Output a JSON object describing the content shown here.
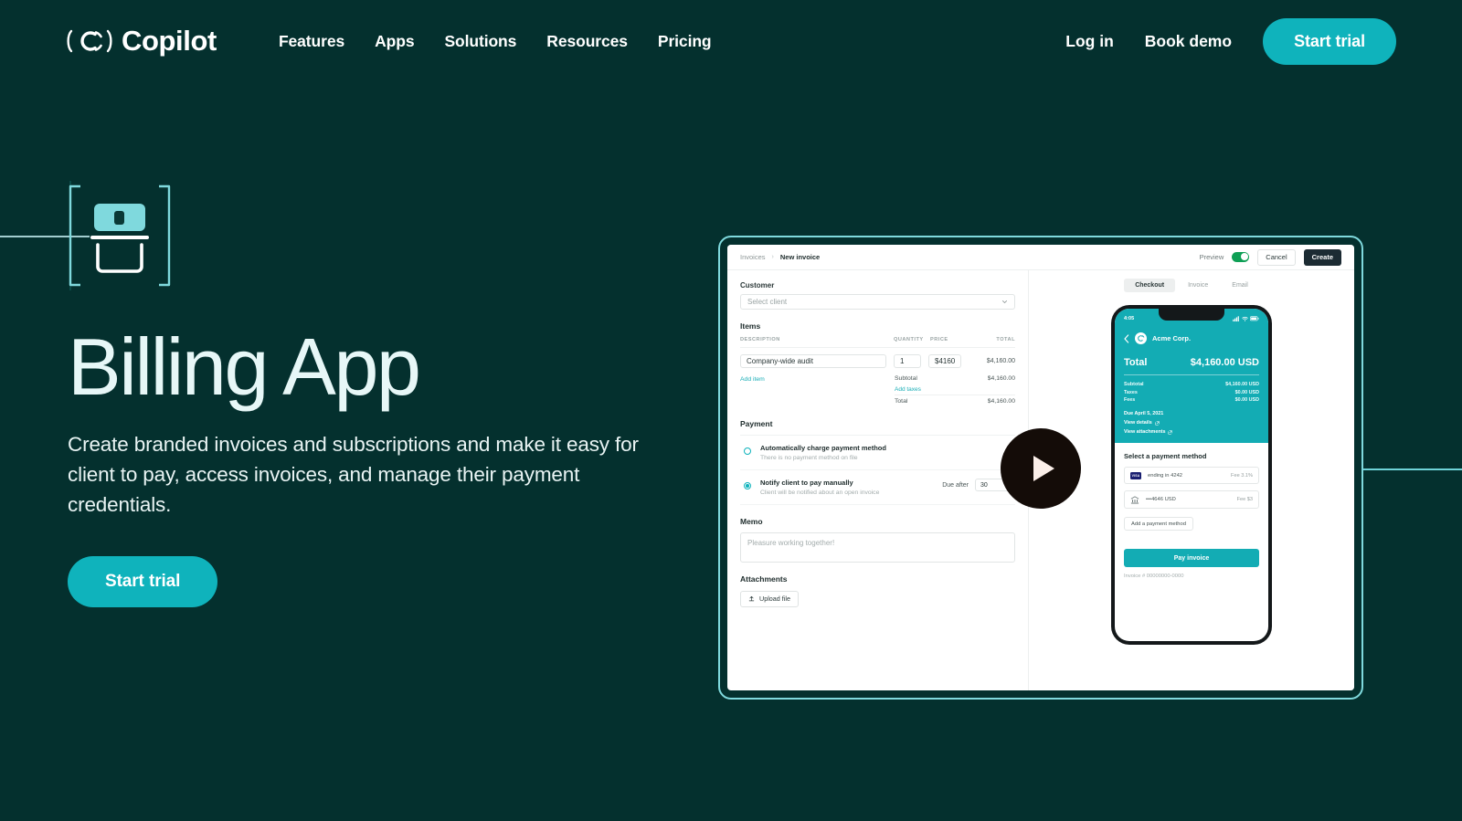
{
  "brand": {
    "name": "Copilot",
    "logo_icon": "copilot-c-bracket-logo"
  },
  "nav": {
    "links": [
      {
        "label": "Features"
      },
      {
        "label": "Apps"
      },
      {
        "label": "Solutions"
      },
      {
        "label": "Resources"
      },
      {
        "label": "Pricing"
      }
    ],
    "login_label": "Log in",
    "demo_label": "Book demo",
    "cta_label": "Start trial"
  },
  "hero": {
    "icon": "billing-card-bracket-icon",
    "title": "Billing App",
    "subtitle": "Create branded invoices and subscriptions and make it easy for client to pay, access invoices, and manage their payment credentials.",
    "cta_label": "Start trial"
  },
  "video": {
    "play_icon": "play-icon"
  },
  "app": {
    "breadcrumb": {
      "parent": "Invoices",
      "separator": "›",
      "current": "New invoice"
    },
    "topbar": {
      "preview_label": "Preview",
      "preview_on": true,
      "cancel_label": "Cancel",
      "create_label": "Create"
    },
    "form": {
      "customer_label": "Customer",
      "customer_placeholder": "Select client",
      "items_label": "Items",
      "item_columns": [
        "DESCRIPTION",
        "QUANTITY",
        "PRICE",
        "TOTAL"
      ],
      "items": [
        {
          "description": "Company-wide audit",
          "quantity": "1",
          "price": "$4160",
          "total": "$4,160.00"
        }
      ],
      "add_item_label": "Add item",
      "subtotal_label": "Subtotal",
      "subtotal_value": "$4,160.00",
      "add_taxes_label": "Add taxes",
      "total_label": "Total",
      "total_value": "$4,160.00",
      "payment_label": "Payment",
      "payment_options": [
        {
          "title": "Automatically charge payment method",
          "subtitle": "There is no payment method on file",
          "selected": false
        },
        {
          "title": "Notify client to pay manually",
          "subtitle": "Client will be notified about an open invoice",
          "selected": true
        }
      ],
      "due_after_label": "Due after",
      "due_after_value": "30",
      "memo_label": "Memo",
      "memo_placeholder": "Pleasure working together!",
      "attachments_label": "Attachments",
      "upload_label": "Upload file",
      "upload_icon": "upload-icon"
    },
    "preview": {
      "tabs": [
        {
          "label": "Checkout",
          "active": true
        },
        {
          "label": "Invoice",
          "active": false
        },
        {
          "label": "Email",
          "active": false
        }
      ],
      "phone": {
        "status_time": "4:05",
        "back_icon": "chevron-left-icon",
        "org_name": "Acme Corp.",
        "org_avatar_icon": "copilot-avatar-icon",
        "total_label": "Total",
        "total_value": "$4,160.00 USD",
        "lines": [
          {
            "label": "Subtotal",
            "value": "$4,160.00 USD"
          },
          {
            "label": "Taxes",
            "value": "$0.00 USD"
          },
          {
            "label": "Fees",
            "value": "$0.00 USD"
          }
        ],
        "due_text": "Due April 5, 2021",
        "links": [
          {
            "label": "View details",
            "icon": "external-link-icon"
          },
          {
            "label": "View attachments",
            "icon": "external-link-icon"
          }
        ],
        "select_method_label": "Select a payment method",
        "methods": [
          {
            "brand": "VISA",
            "icon": "visa-card-icon",
            "text": "ending in 4242",
            "fee": "Fee 3.1%"
          },
          {
            "brand": "BANK",
            "icon": "bank-icon",
            "text": "•••4646 USD",
            "fee": "Fee $3"
          }
        ],
        "add_method_label": "Add a payment method",
        "pay_label": "Pay invoice",
        "invoice_number": "Invoice # 00000000-0000"
      }
    }
  },
  "colors": {
    "background": "#04302E",
    "accent": "#0FB3BC",
    "accent_light": "#7FD9DD",
    "text_light": "#E7F7F7",
    "phone_teal": "#13ACB4",
    "toggle_green": "#0E9F55"
  }
}
